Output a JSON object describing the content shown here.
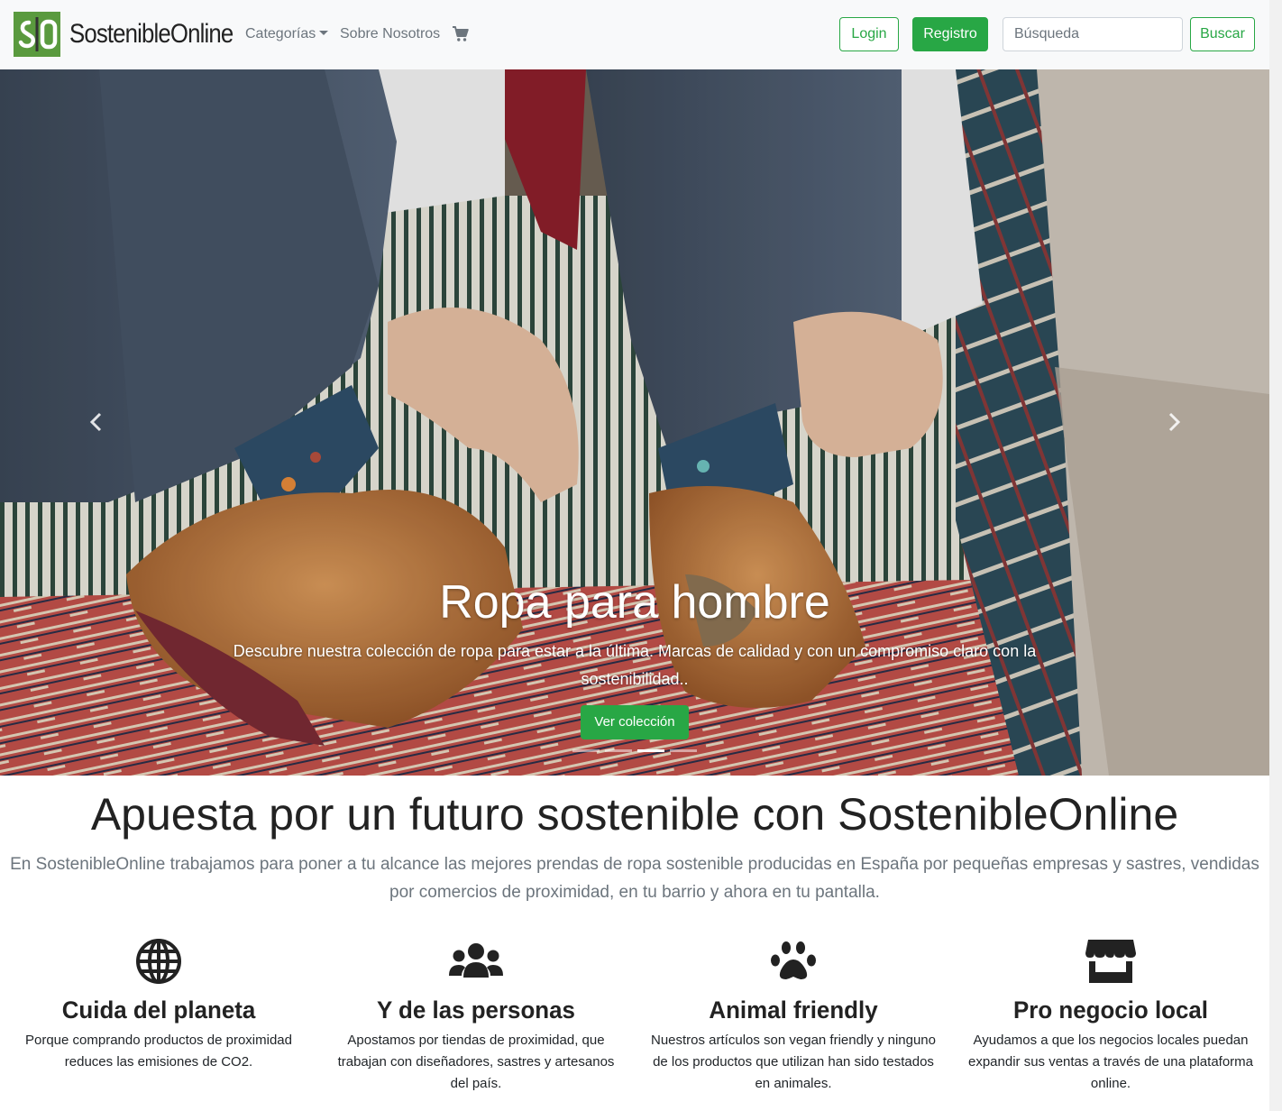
{
  "navbar": {
    "logo_text": "S|O",
    "brand": "SostenibleOnline",
    "links": {
      "categories": "Categorías",
      "about": "Sobre Nosotros"
    },
    "login": "Login",
    "register": "Registro",
    "search_placeholder": "Búsqueda",
    "search_button": "Buscar",
    "colors": {
      "accent": "#28a745",
      "logo_green": "#5a9a3e"
    }
  },
  "carousel": {
    "title": "Ropa para hombre",
    "text": "Descubre nuestra colección de ropa para estar a la última. Marcas de calidad y con un compromiso claro con la sostenibilidad..",
    "cta": "Ver colección",
    "slides": 4,
    "active_slide": 3,
    "icons": [
      "chevron-left-icon",
      "chevron-right-icon"
    ]
  },
  "intro": {
    "headline": "Apuesta por un futuro sostenible con SostenibleOnline",
    "lead": "En SostenibleOnline trabajamos para poner a tu alcance las mejores prendas de ropa sostenible producidas en España por pequeñas empresas y sastres, vendidas por comercios de proximidad, en tu barrio y ahora en tu pantalla."
  },
  "features": [
    {
      "icon": "globe-icon",
      "title": "Cuida del planeta",
      "text": "Porque comprando productos de proximidad reduces las emisiones de CO2."
    },
    {
      "icon": "users-icon",
      "title": "Y de las personas",
      "text": "Apostamos por tiendas de proximidad, que trabajan con diseñadores, sastres y artesanos del país."
    },
    {
      "icon": "paw-icon",
      "title": "Animal friendly",
      "text": "Nuestros artículos son vegan friendly y ninguno de los productos que utilizan han sido testados en animales."
    },
    {
      "icon": "store-icon",
      "title": "Pro negocio local",
      "text": "Ayudamos a que los negocios locales puedan expandir sus ventas a través de una plataforma online."
    }
  ]
}
